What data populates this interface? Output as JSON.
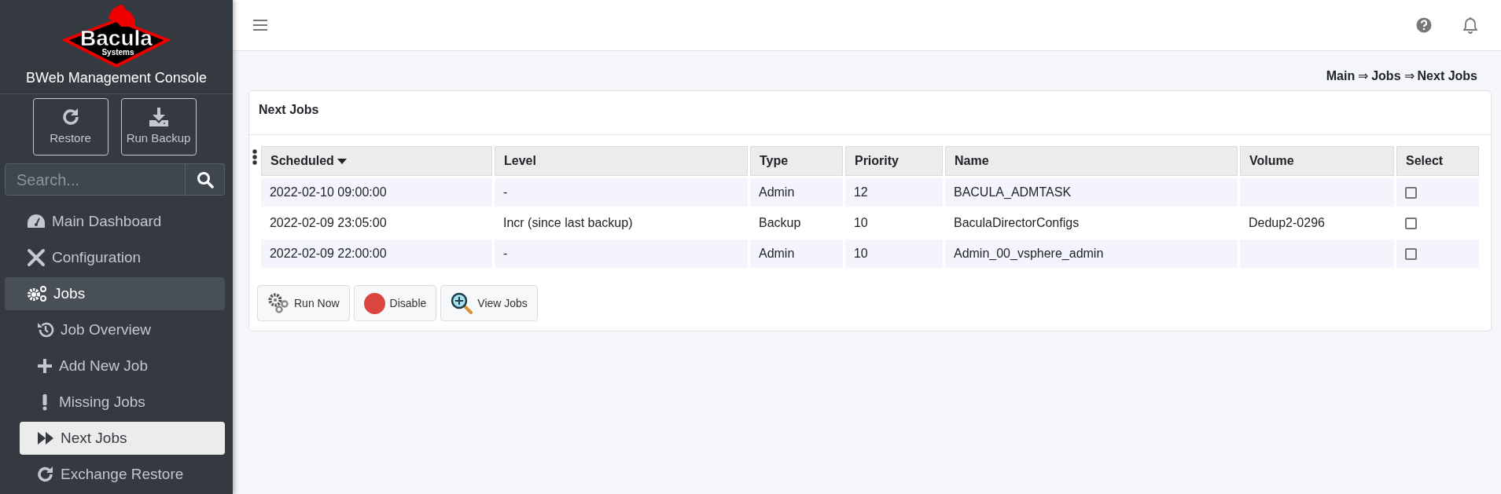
{
  "logo": {
    "name": "Bacula",
    "sub": "Systems"
  },
  "console_title": "BWeb Management Console",
  "quick_actions": [
    {
      "label": "Restore"
    },
    {
      "label": "Run Backup"
    }
  ],
  "search": {
    "placeholder": "Search..."
  },
  "sidebar": {
    "items": [
      {
        "label": "Main Dashboard",
        "selected": false
      },
      {
        "label": "Configuration",
        "selected": false
      },
      {
        "label": "Jobs",
        "selected": false,
        "expanded": true,
        "children": [
          {
            "label": "Job Overview",
            "selected": false
          },
          {
            "label": "Add New Job",
            "selected": false
          },
          {
            "label": "Missing Jobs",
            "selected": false
          },
          {
            "label": "Next Jobs",
            "selected": true
          },
          {
            "label": "Exchange Restore",
            "selected": false
          }
        ]
      }
    ]
  },
  "breadcrumb": [
    "Main",
    "⇒",
    "Jobs",
    "⇒",
    "Next Jobs"
  ],
  "card": {
    "title": "Next Jobs",
    "table": {
      "columns": [
        {
          "label": "Scheduled",
          "sorted": true
        },
        {
          "label": "Level"
        },
        {
          "label": "Type"
        },
        {
          "label": "Priority"
        },
        {
          "label": "Name"
        },
        {
          "label": "Volume"
        },
        {
          "label": "Select"
        }
      ],
      "rows": [
        {
          "scheduled": "2022-02-10 09:00:00",
          "level": "-",
          "type": "Admin",
          "priority": "12",
          "name": "BACULA_ADMTASK",
          "selected": false
        },
        {
          "scheduled": "2022-02-09 23:05:00",
          "level": "Incr (since last backup)",
          "type": "Backup",
          "priority": "10",
          "name": "BaculaDirectorConfigs",
          "volume": "Dedup2-0296",
          "selected": false
        },
        {
          "scheduled": "2022-02-09 22:00:00",
          "level": "-",
          "type": "Admin",
          "priority": "10",
          "name": "Admin_00_vsphere_admin",
          "selected": false
        }
      ]
    },
    "actions": [
      {
        "label": "Run Now"
      },
      {
        "label": "Disable"
      },
      {
        "label": "View Jobs"
      }
    ]
  }
}
